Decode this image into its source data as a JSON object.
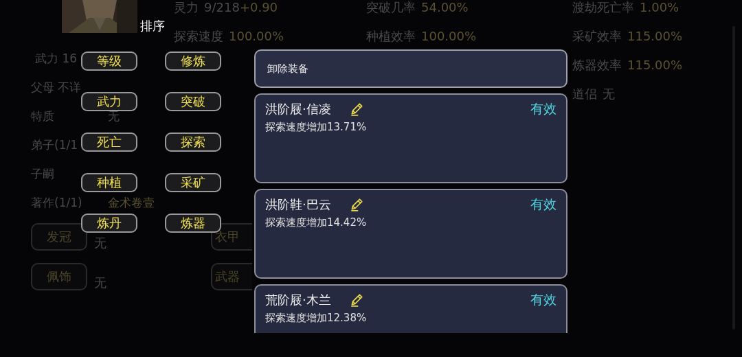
{
  "stat_columns": [
    [
      {
        "label": "灵力",
        "value": "9/218",
        "gain": "+0.90",
        "kind": "plain"
      },
      {
        "label": "探索速度",
        "value": "100.00%",
        "kind": "gold"
      }
    ],
    [
      {
        "label": "突破几率",
        "value": "54.00%",
        "kind": "gold"
      },
      {
        "label": "种植效率",
        "value": "100.00%",
        "kind": "gold"
      }
    ],
    [
      {
        "label": "渡劫死亡率",
        "value": "1.00%",
        "kind": "gold"
      },
      {
        "label": "采矿效率",
        "value": "115.00%",
        "kind": "gold"
      },
      {
        "label": "炼器效率",
        "value": "115.00%",
        "kind": "gold"
      },
      {
        "label": "道侣",
        "value": "无",
        "kind": "plain"
      }
    ]
  ],
  "profile": [
    {
      "label": "武力 16"
    },
    {
      "label": "父母 不详"
    },
    {
      "label": "特质",
      "value": "无",
      "kind": "plain"
    },
    {
      "label": "弟子(1/1"
    },
    {
      "label": "子嗣"
    },
    {
      "label": "著作(1/1)",
      "value": "金术卷壹",
      "kind": "gold"
    }
  ],
  "slots": [
    {
      "label": "发冠",
      "value": "无"
    },
    {
      "label": "衣甲"
    },
    {
      "label": "佩饰",
      "value": "无"
    },
    {
      "label": "武器"
    }
  ],
  "sort_menu": {
    "title": "排序",
    "options": [
      "等级",
      "修炼",
      "武力",
      "突破",
      "死亡",
      "探索",
      "种植",
      "采矿",
      "炼丹",
      "炼器"
    ]
  },
  "equipment_panel": {
    "unequip": "卸除装备",
    "items": [
      {
        "name": "洪阶屐·信凌",
        "effect": "探索速度增加13.71%",
        "status": "有效"
      },
      {
        "name": "洪阶鞋·巴云",
        "effect": "探索速度增加14.42%",
        "status": "有效"
      },
      {
        "name": "荒阶屐·木兰",
        "effect": "探索速度增加12.38%",
        "status": "有效"
      }
    ]
  }
}
